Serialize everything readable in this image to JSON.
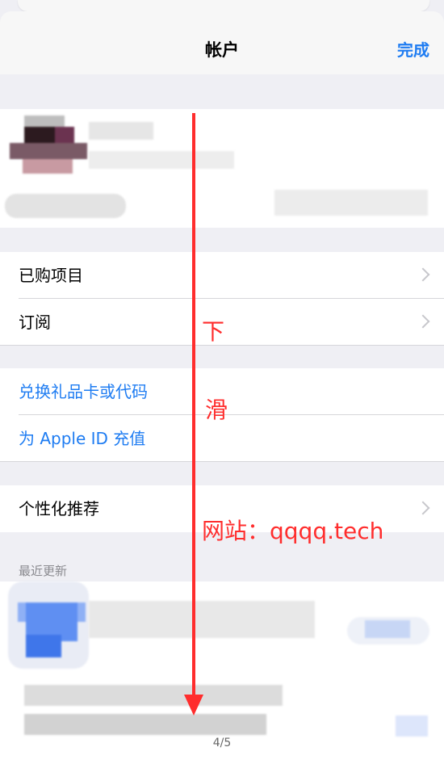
{
  "nav": {
    "title": "帐户",
    "done": "完成"
  },
  "rows": {
    "purchased": "已购项目",
    "subscriptions": "订阅",
    "redeem": "兑换礼品卡或代码",
    "add_funds": "为 Apple ID 充值",
    "personalized": "个性化推荐"
  },
  "recent_header": "最近更新",
  "annotation": {
    "line1": "下",
    "line2": "滑",
    "website": "网站：qqqq.tech"
  },
  "page_indicator": "4/5",
  "colors": {
    "accent": "#1e7cf2",
    "annotation": "#ff2d2d"
  }
}
